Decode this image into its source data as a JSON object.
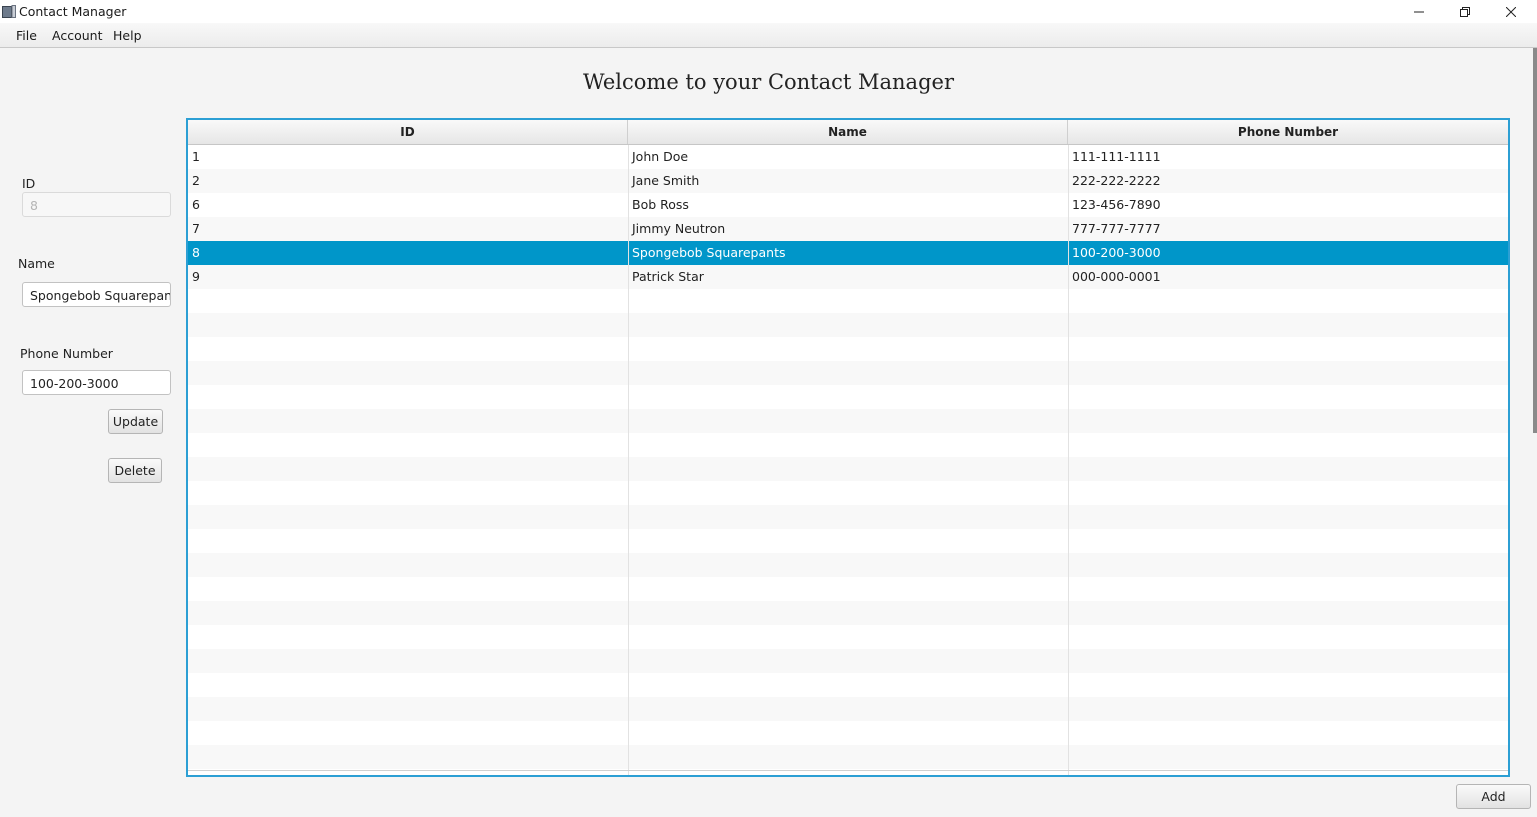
{
  "window": {
    "title": "Contact Manager",
    "icons": {
      "app": "java-app-icon",
      "minimize": "minimize-icon",
      "restore": "restore-icon",
      "close": "close-icon"
    }
  },
  "menu": {
    "items": [
      "File",
      "Account",
      "Help"
    ]
  },
  "heading": "Welcome to your Contact Manager",
  "form": {
    "id_label": "ID",
    "id_value": "8",
    "name_label": "Name",
    "name_value": "Spongebob Squarepants",
    "phone_label": "Phone Number",
    "phone_value": "100-200-3000",
    "update_button": "Update",
    "delete_button": "Delete"
  },
  "table": {
    "columns": [
      "ID",
      "Name",
      "Phone Number"
    ],
    "rows": [
      {
        "id": "1",
        "name": "John Doe",
        "phone": "111-111-1111"
      },
      {
        "id": "2",
        "name": "Jane Smith",
        "phone": "222-222-2222"
      },
      {
        "id": "6",
        "name": "Bob Ross",
        "phone": "123-456-7890"
      },
      {
        "id": "7",
        "name": "Jimmy Neutron",
        "phone": "777-777-7777"
      },
      {
        "id": "8",
        "name": "Spongebob Squarepants",
        "phone": "100-200-3000"
      },
      {
        "id": "9",
        "name": "Patrick Star",
        "phone": "000-000-0001"
      }
    ],
    "selected_row": 4,
    "accent_color": "#2c9fd4",
    "selection_color": "#0096c9"
  },
  "add_button": "Add"
}
